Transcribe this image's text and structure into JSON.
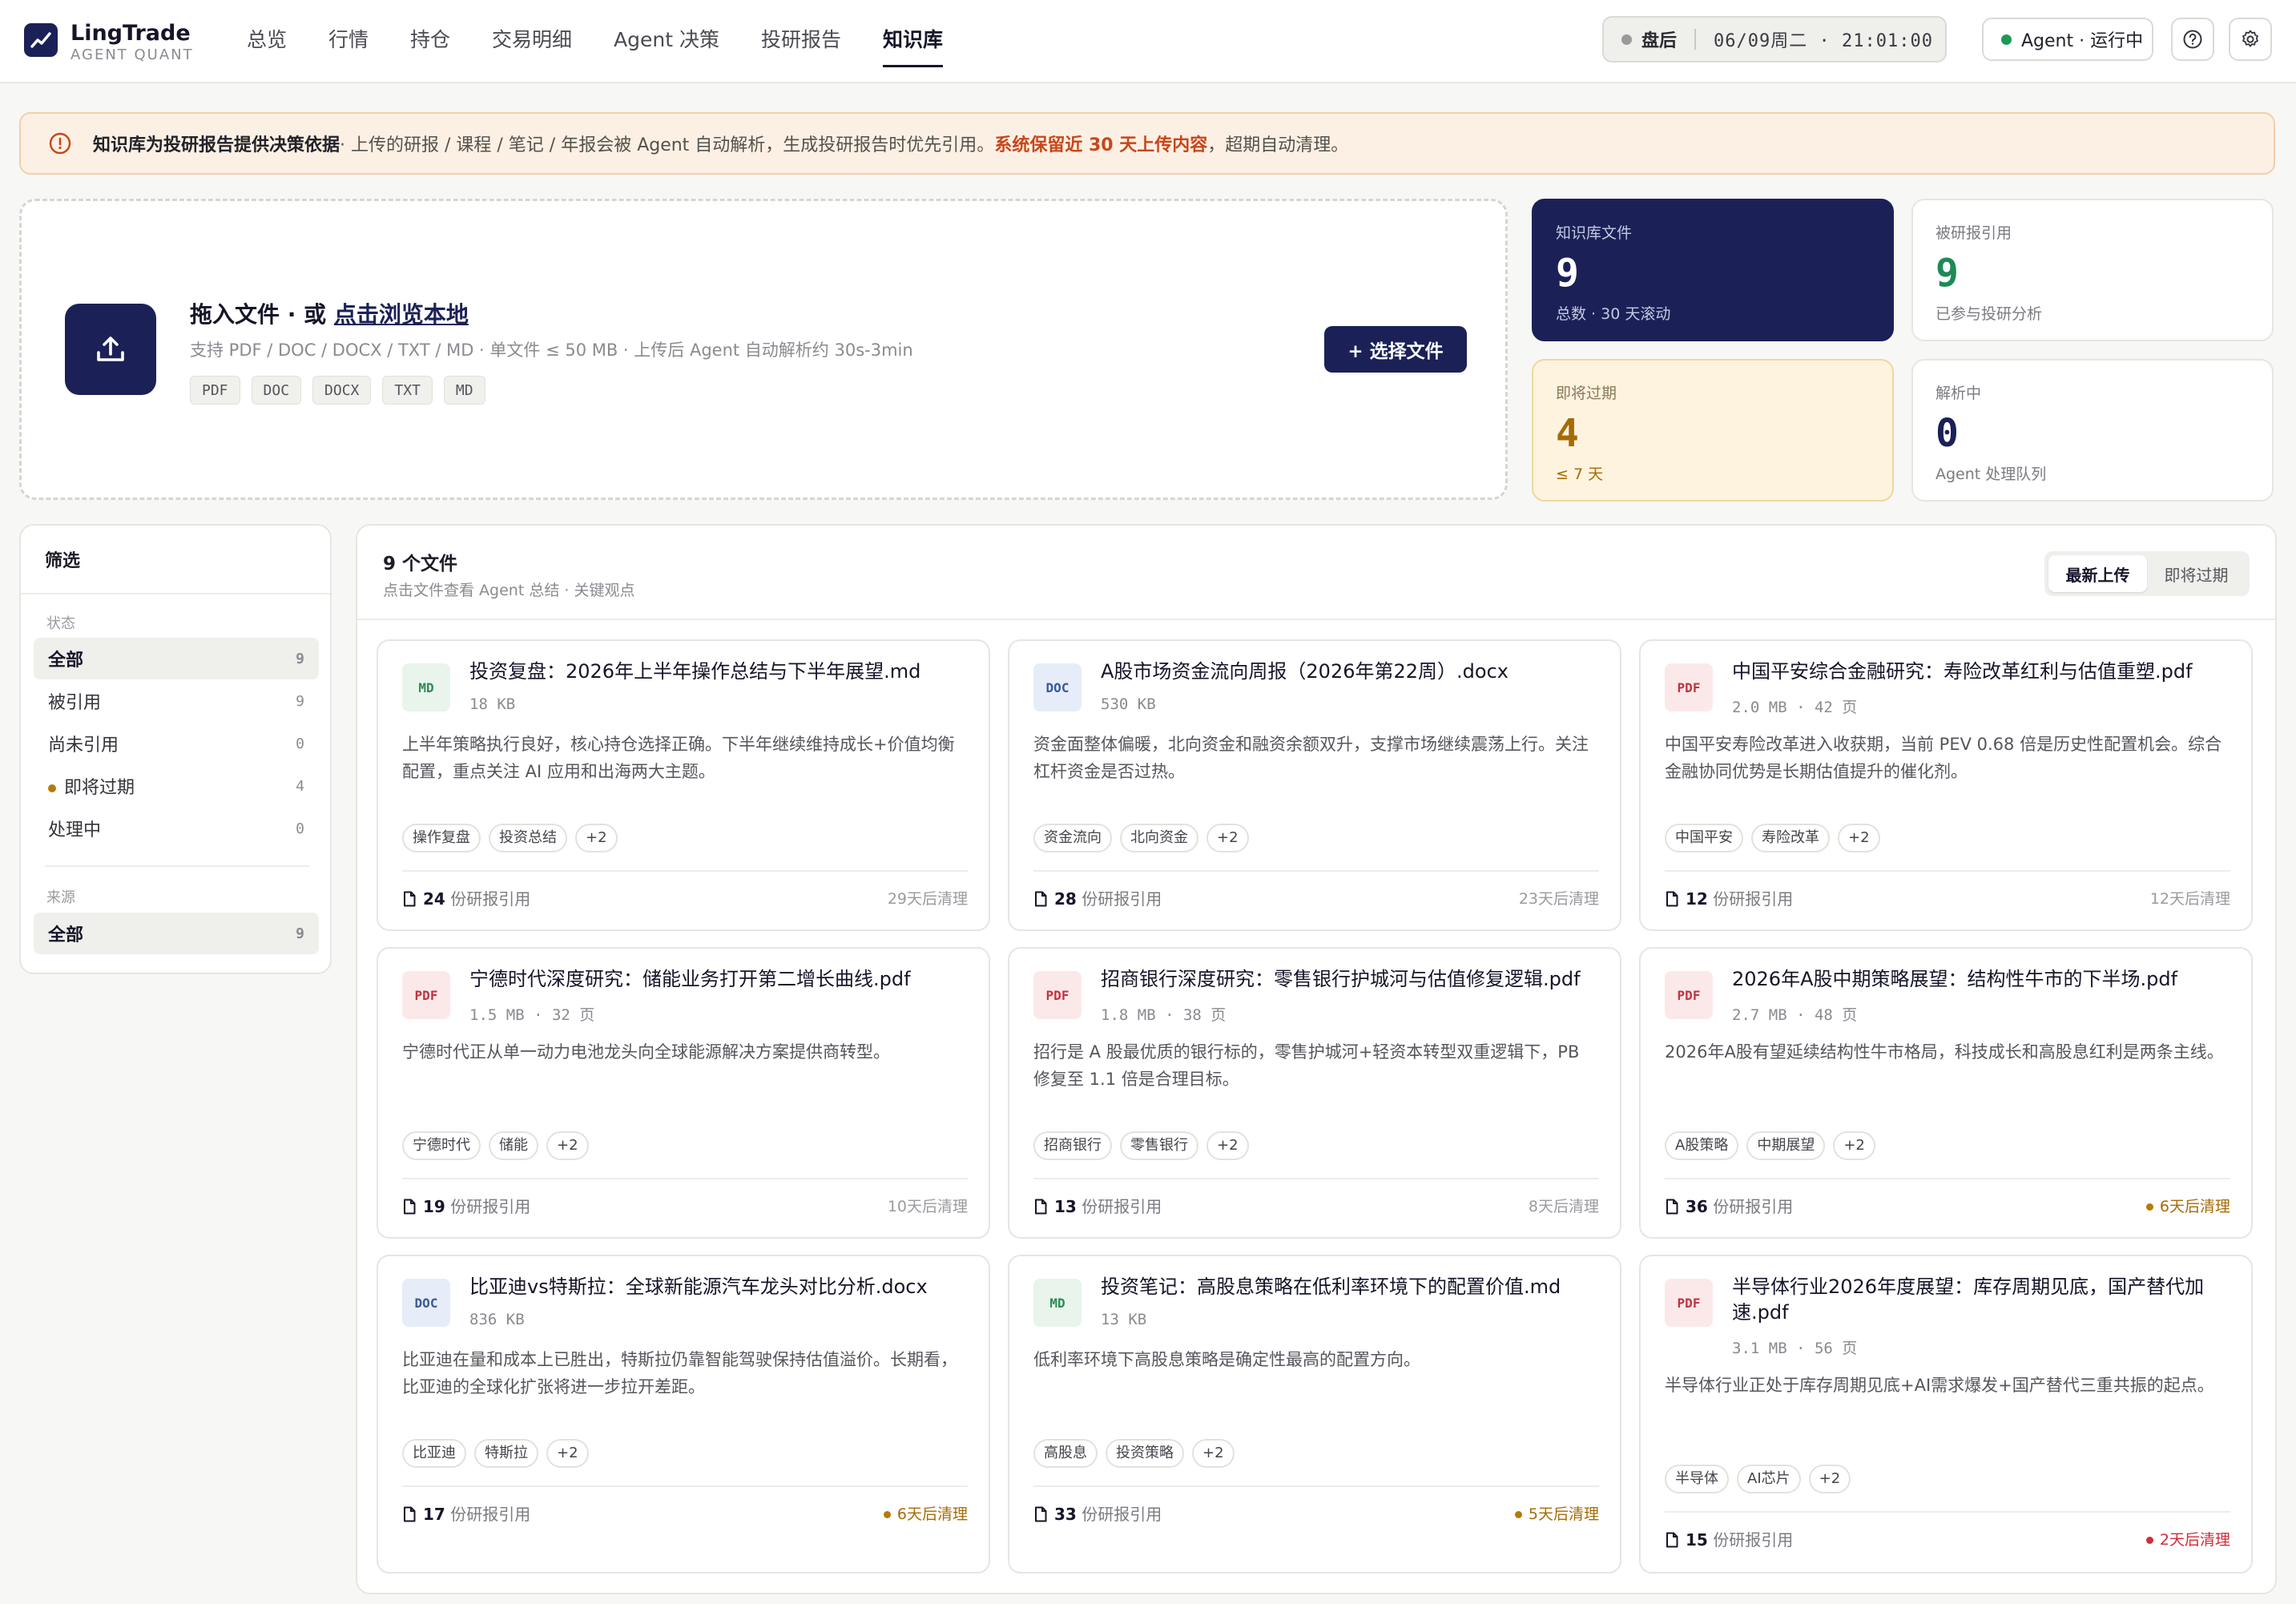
{
  "brand": {
    "name": "LingTrade",
    "sub": "AGENT QUANT",
    "logo_icon": "trend-line-icon"
  },
  "nav": {
    "items": [
      "总览",
      "行情",
      "持仓",
      "交易明细",
      "Agent 决策",
      "投研报告",
      "知识库"
    ],
    "active": "知识库"
  },
  "market": {
    "session": "盘后",
    "datetime": "06/09周二 · 21:01:00"
  },
  "agent": {
    "status": "Agent · 运行中"
  },
  "banner": {
    "lead": "知识库为投研报告提供决策依据",
    "text": "· 上传的研报 / 课程 / 笔记 / 年报会被 Agent 自动解析，生成投研报告时优先引用。",
    "warn": "系统保留近 30 天上传内容",
    "tail": "，超期自动清理。"
  },
  "upload": {
    "title_prefix": "拖入文件 · 或 ",
    "title_link": "点击浏览本地",
    "hint": "支持 PDF / DOC / DOCX / TXT / MD · 单文件 ≤ 50 MB · 上传后 Agent 自动解析约 30s-3min",
    "formats": [
      "PDF",
      "DOC",
      "DOCX",
      "TXT",
      "MD"
    ],
    "button": "+ 选择文件"
  },
  "stats": {
    "files": {
      "label": "知识库文件",
      "value": "9",
      "sub": "总数 · 30 天滚动"
    },
    "cited": {
      "label": "被研报引用",
      "value": "9",
      "sub": "已参与投研分析"
    },
    "expiring": {
      "label": "即将过期",
      "value": "4",
      "sub": "≤ 7 天"
    },
    "parsing": {
      "label": "解析中",
      "value": "0",
      "sub": "Agent 处理队列"
    }
  },
  "filter": {
    "title": "筛选",
    "status_label": "状态",
    "status": [
      {
        "label": "全部",
        "count": "9"
      },
      {
        "label": "被引用",
        "count": "9"
      },
      {
        "label": "尚未引用",
        "count": "0"
      },
      {
        "label": "即将过期",
        "count": "4"
      },
      {
        "label": "处理中",
        "count": "0"
      }
    ],
    "source_label": "来源",
    "source": [
      {
        "label": "全部",
        "count": "9"
      }
    ]
  },
  "list": {
    "title": "9 个文件",
    "subtitle": "点击文件查看 Agent 总结 · 关键观点",
    "sort": [
      "最新上传",
      "即将过期"
    ]
  },
  "cards": [
    {
      "type": "MD",
      "name": "投资复盘：2026年上半年操作总结与下半年展望.md",
      "meta": "18 KB",
      "desc": "上半年策略执行良好，核心持仓选择正确。下半年继续维持成长+价值均衡配置，重点关注 AI 应用和出海两大主题。",
      "tags": [
        "操作复盘",
        "投资总结",
        "+2"
      ],
      "cites": "24",
      "cite_label": " 份研报引用",
      "expire": "29天后清理",
      "level": "normal"
    },
    {
      "type": "DOC",
      "name": "A股市场资金流向周报（2026年第22周）.docx",
      "meta": "530 KB",
      "desc": "资金面整体偏暖，北向资金和融资余额双升，支撑市场继续震荡上行。关注杠杆资金是否过热。",
      "tags": [
        "资金流向",
        "北向资金",
        "+2"
      ],
      "cites": "28",
      "cite_label": " 份研报引用",
      "expire": "23天后清理",
      "level": "normal"
    },
    {
      "type": "PDF",
      "name": "中国平安综合金融研究：寿险改革红利与估值重塑.pdf",
      "meta": "2.0 MB · 42 页",
      "desc": "中国平安寿险改革进入收获期，当前 PEV 0.68 倍是历史性配置机会。综合金融协同优势是长期估值提升的催化剂。",
      "tags": [
        "中国平安",
        "寿险改革",
        "+2"
      ],
      "cites": "12",
      "cite_label": " 份研报引用",
      "expire": "12天后清理",
      "level": "normal"
    },
    {
      "type": "PDF",
      "name": "宁德时代深度研究：储能业务打开第二增长曲线.pdf",
      "meta": "1.5 MB · 32 页",
      "desc": "宁德时代正从单一动力电池龙头向全球能源解决方案提供商转型。",
      "tags": [
        "宁德时代",
        "储能",
        "+2"
      ],
      "cites": "19",
      "cite_label": " 份研报引用",
      "expire": "10天后清理",
      "level": "normal"
    },
    {
      "type": "PDF",
      "name": "招商银行深度研究：零售银行护城河与估值修复逻辑.pdf",
      "meta": "1.8 MB · 38 页",
      "desc": "招行是 A 股最优质的银行标的，零售护城河+轻资本转型双重逻辑下，PB 修复至 1.1 倍是合理目标。",
      "tags": [
        "招商银行",
        "零售银行",
        "+2"
      ],
      "cites": "13",
      "cite_label": " 份研报引用",
      "expire": "8天后清理",
      "level": "normal"
    },
    {
      "type": "PDF",
      "name": "2026年A股中期策略展望：结构性牛市的下半场.pdf",
      "meta": "2.7 MB · 48 页",
      "desc": "2026年A股有望延续结构性牛市格局，科技成长和高股息红利是两条主线。",
      "tags": [
        "A股策略",
        "中期展望",
        "+2"
      ],
      "cites": "36",
      "cite_label": " 份研报引用",
      "expire": "6天后清理",
      "level": "warn"
    },
    {
      "type": "DOC",
      "name": "比亚迪vs特斯拉：全球新能源汽车龙头对比分析.docx",
      "meta": "836 KB",
      "desc": "比亚迪在量和成本上已胜出，特斯拉仍靠智能驾驶保持估值溢价。长期看，比亚迪的全球化扩张将进一步拉开差距。",
      "tags": [
        "比亚迪",
        "特斯拉",
        "+2"
      ],
      "cites": "17",
      "cite_label": " 份研报引用",
      "expire": "6天后清理",
      "level": "warn"
    },
    {
      "type": "MD",
      "name": "投资笔记：高股息策略在低利率环境下的配置价值.md",
      "meta": "13 KB",
      "desc": "低利率环境下高股息策略是确定性最高的配置方向。",
      "tags": [
        "高股息",
        "投资策略",
        "+2"
      ],
      "cites": "33",
      "cite_label": " 份研报引用",
      "expire": "5天后清理",
      "level": "warn"
    },
    {
      "type": "PDF",
      "name": "半导体行业2026年度展望：库存周期见底，国产替代加速.pdf",
      "meta": "3.1 MB · 56 页",
      "desc": "半导体行业正处于库存周期见底+AI需求爆发+国产替代三重共振的起点。",
      "tags": [
        "半导体",
        "AI芯片",
        "+2"
      ],
      "cites": "15",
      "cite_label": " 份研报引用",
      "expire": "2天后清理",
      "level": "crit"
    }
  ]
}
